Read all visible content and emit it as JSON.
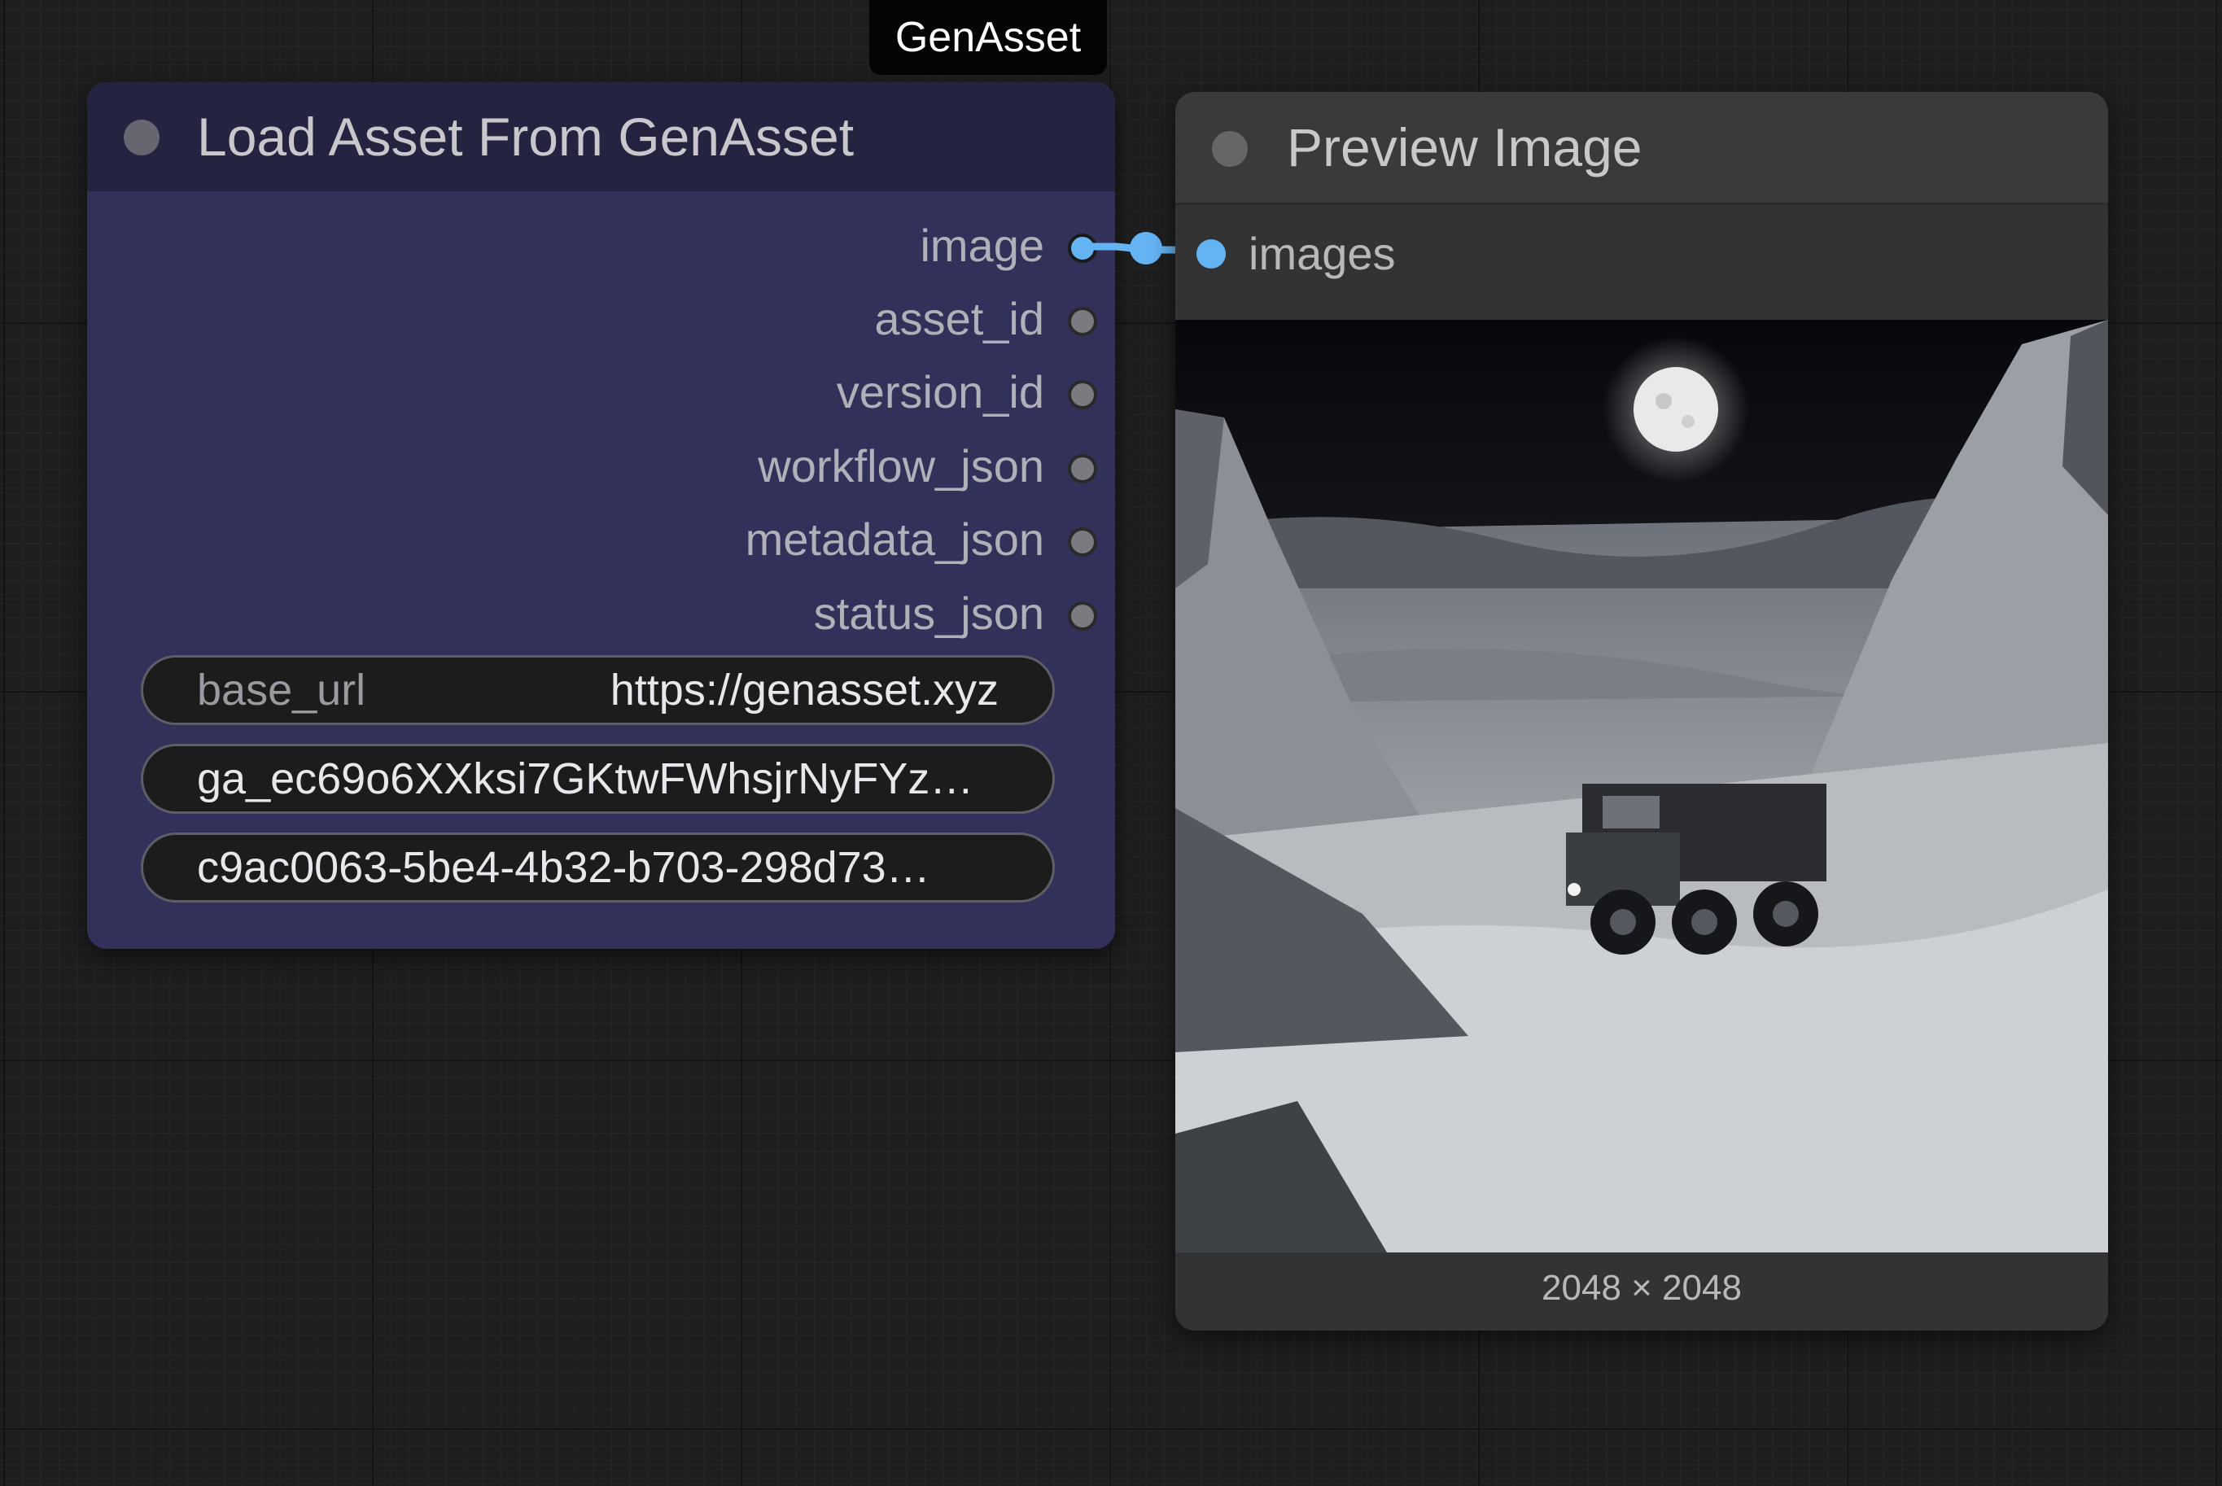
{
  "group": {
    "label": "GenAsset"
  },
  "load_node": {
    "title": "Load Asset From GenAsset",
    "outputs": [
      {
        "label": "image",
        "connected": true
      },
      {
        "label": "asset_id",
        "connected": false
      },
      {
        "label": "version_id",
        "connected": false
      },
      {
        "label": "workflow_json",
        "connected": false
      },
      {
        "label": "metadata_json",
        "connected": false
      },
      {
        "label": "status_json",
        "connected": false
      }
    ],
    "widgets": {
      "base_url_name": "base_url",
      "base_url_value": "https://genasset.xyz",
      "api_key_value": "ga_ec69o6XXksi7GKtwFWhsjrNyFYz…",
      "asset_uuid_value": "c9ac0063-5be4-4b32-b703-298d73…"
    }
  },
  "preview_node": {
    "title": "Preview Image",
    "input_label": "images",
    "image_alt": "moonlit canyon with armored truck",
    "dimensions": "2048 × 2048"
  },
  "colors": {
    "link": "#64b4f4",
    "load_node_body": "#31315a",
    "load_node_header": "#242440",
    "preview_body": "#333333"
  }
}
